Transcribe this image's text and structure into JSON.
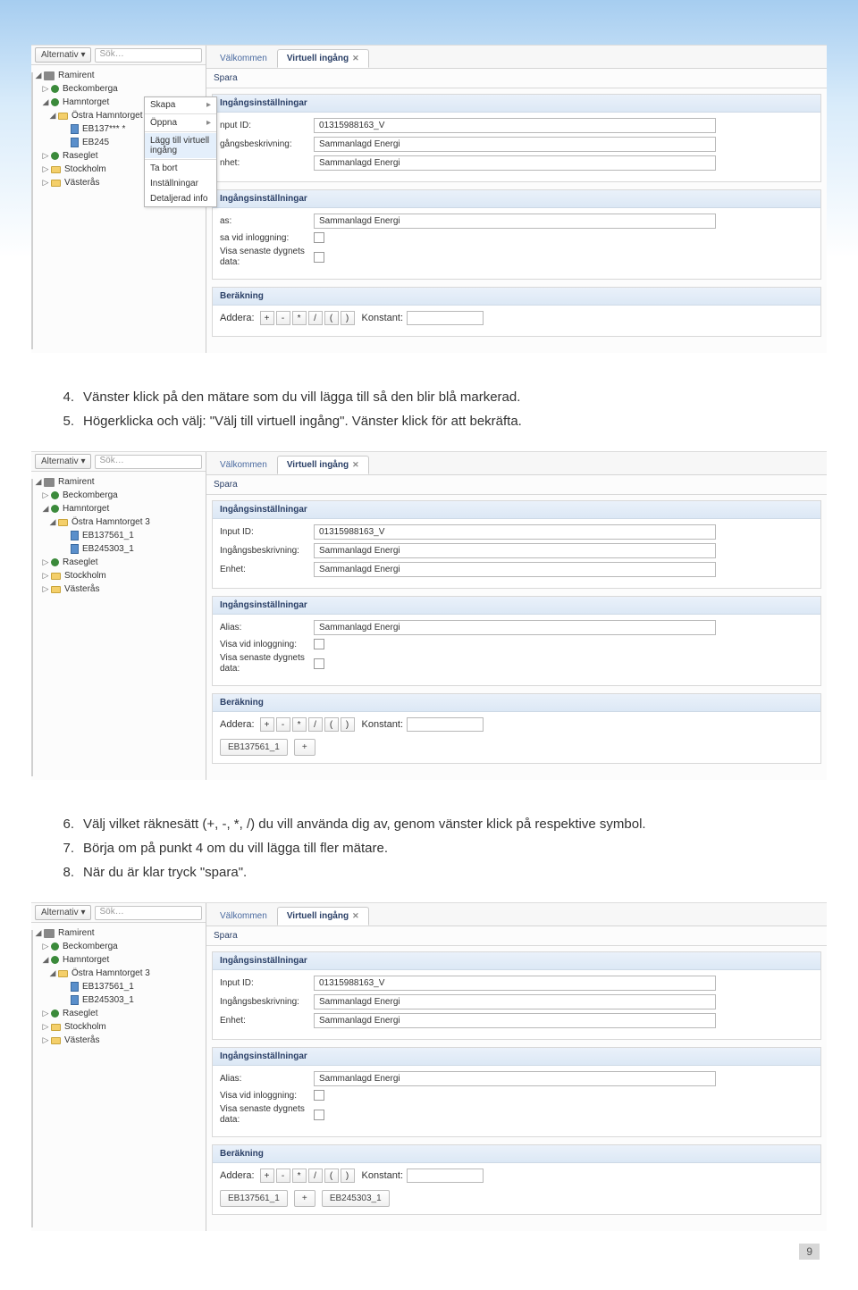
{
  "toolbar": {
    "alt_label": "Alternativ ▾",
    "search_placeholder": "Sök…"
  },
  "tree": {
    "root": "Ramirent",
    "nodes": [
      "Beckomberga",
      "Hamntorget",
      "Östra Hamntorget 3"
    ],
    "device1_a": "EB137***  *",
    "device2_a": "EB245",
    "device1_b": "EB137561_1",
    "device2_b": "EB245303_1",
    "raseglet": "Raseglet",
    "stockholm": "Stockholm",
    "vasteras": "Västerås"
  },
  "ctx": {
    "skapa": "Skapa",
    "oppna": "Öppna",
    "lagg": "Lägg till virtuell ingång",
    "tabort": "Ta bort",
    "inst": "Inställningar",
    "det": "Detaljerad info"
  },
  "tabs": {
    "valkommen": "Välkommen",
    "virtuell": "Virtuell ingång"
  },
  "spara": "Spara",
  "panelheads": {
    "ing": "Ingångsinställningar",
    "ber": "Beräkning"
  },
  "labels": {
    "input_id": "Input ID:",
    "input_id_trunc": "nput ID:",
    "beskr": "Ingångsbeskrivning:",
    "beskr_trunc": "gångsbeskrivning:",
    "enhet": "Enhet:",
    "enhet_trunc": "nhet:",
    "alias": "Alias:",
    "alias_trunc": "as:",
    "visa_login": "Visa vid inloggning:",
    "visa_login_trunc": "sa vid inloggning:",
    "visa_dygn": "Visa senaste dygnets data:",
    "addera": "Addera:",
    "konstant": "Konstant:"
  },
  "vals": {
    "input_id": "01315988163_V",
    "energi": "Sammanlagd Energi"
  },
  "ops": [
    "+",
    "-",
    "*",
    "/",
    "(",
    ")"
  ],
  "chips_s3": {
    "a": "EB137561_1",
    "b": "EB245303_1",
    "plus": "+"
  },
  "instructions": {
    "i4": "Vänster klick på den mätare som du vill lägga till så den blir blå markerad.",
    "i5": "Högerklicka och välj: \"Välj till virtuell ingång\". Vänster klick för att bekräfta.",
    "i6": "Välj vilket räknesätt (+, -, *, /) du vill använda dig av, genom vänster klick på respektive symbol.",
    "i7": "Börja om på punkt 4 om du vill lägga till fler mätare.",
    "i8": "När du är klar tryck \"spara\"."
  },
  "page_number": "9"
}
